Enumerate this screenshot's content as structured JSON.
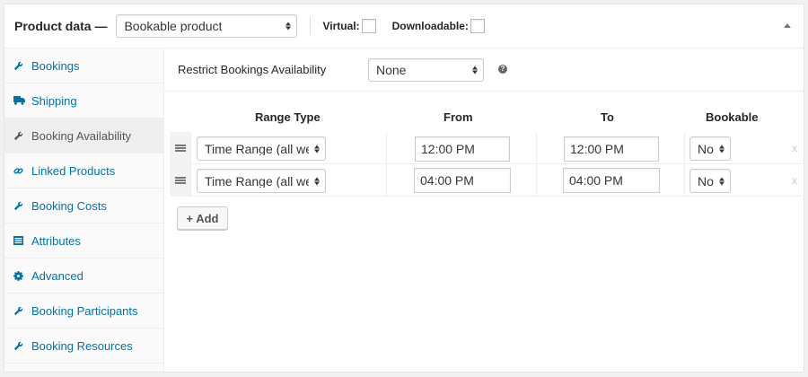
{
  "header": {
    "title": "Product data —",
    "product_type": "Bookable product",
    "virtual_label": "Virtual:",
    "downloadable_label": "Downloadable:"
  },
  "sidebar": {
    "items": [
      {
        "label": "Bookings",
        "icon": "wrench-icon",
        "active": false
      },
      {
        "label": "Shipping",
        "icon": "truck-icon",
        "active": false
      },
      {
        "label": "Booking Availability",
        "icon": "wrench-icon",
        "active": true
      },
      {
        "label": "Linked Products",
        "icon": "link-icon",
        "active": false
      },
      {
        "label": "Booking Costs",
        "icon": "wrench-icon",
        "active": false
      },
      {
        "label": "Attributes",
        "icon": "list-icon",
        "active": false
      },
      {
        "label": "Advanced",
        "icon": "gear-icon",
        "active": false
      },
      {
        "label": "Booking Participants",
        "icon": "wrench-icon",
        "active": false
      },
      {
        "label": "Booking Resources",
        "icon": "wrench-icon",
        "active": false
      }
    ]
  },
  "availability": {
    "restrict_label": "Restrict Bookings Availability",
    "restrict_value": "None",
    "help": "?",
    "columns": {
      "range_type": "Range Type",
      "from": "From",
      "to": "To",
      "bookable": "Bookable"
    },
    "rows": [
      {
        "range_type": "Time Range (all week)",
        "from": "12:00 PM",
        "to": "12:00 PM",
        "bookable": "No",
        "delete": "x"
      },
      {
        "range_type": "Time Range (all week)",
        "from": "04:00 PM",
        "to": "04:00 PM",
        "bookable": "No",
        "delete": "x"
      }
    ],
    "add_label": "+ Add"
  }
}
